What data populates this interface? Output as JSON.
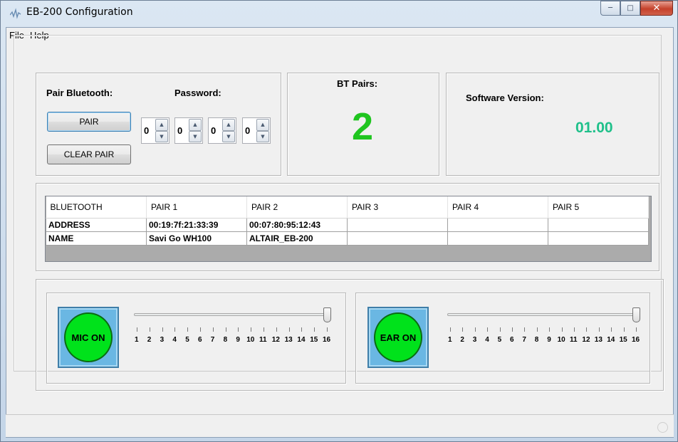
{
  "window": {
    "title": "EB-200 Configuration",
    "icon": "app-waveform-icon"
  },
  "menu": {
    "items": [
      "File",
      "Help"
    ]
  },
  "pairing": {
    "pair_bluetooth_label": "Pair Bluetooth:",
    "password_label": "Password:",
    "pair_button": "PAIR",
    "clear_pair_button": "CLEAR PAIR",
    "password_digits": [
      "0",
      "0",
      "0",
      "0"
    ]
  },
  "bt_pairs": {
    "label": "BT Pairs:",
    "value": "2",
    "color": "#1fc51f"
  },
  "software": {
    "label": "Software Version:",
    "value": "01.00",
    "color": "#1fc08a"
  },
  "pair_table": {
    "headers": [
      "BLUETOOTH",
      "PAIR 1",
      "PAIR 2",
      "PAIR 3",
      "PAIR 4",
      "PAIR 5"
    ],
    "rows": [
      [
        "ADDRESS",
        "00:19:7f:21:33:39",
        "00:07:80:95:12:43",
        "",
        "",
        ""
      ],
      [
        "NAME",
        "Savi Go WH100",
        "ALTAIR_EB-200",
        "",
        "",
        ""
      ]
    ]
  },
  "mic": {
    "button_label": "MIC ON",
    "level": 16
  },
  "ear": {
    "button_label": "EAR ON",
    "level": 16
  },
  "slider_ticks": [
    "1",
    "2",
    "3",
    "4",
    "5",
    "6",
    "7",
    "8",
    "9",
    "10",
    "11",
    "12",
    "13",
    "14",
    "15",
    "16"
  ],
  "colors": {
    "button_on_green": "#00e21b",
    "button_frame_blue": "#6ab7e3"
  }
}
